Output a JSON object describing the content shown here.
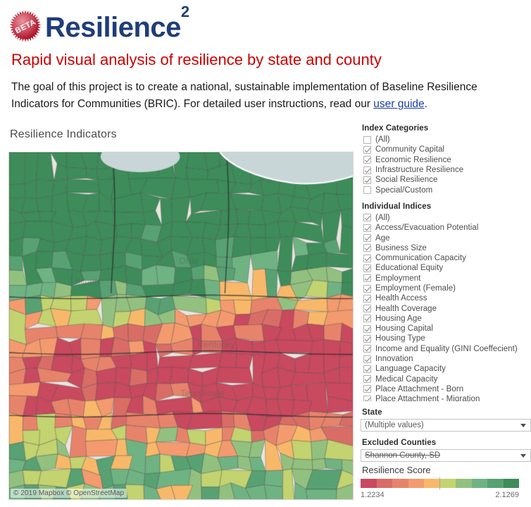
{
  "brand": {
    "badge_text": "BETA",
    "name": "Resilience",
    "superscript": "2",
    "badge_color": "#c02032",
    "name_color": "#1f3d7a"
  },
  "subtitle": "Rapid visual analysis of resilience by state and county",
  "intro": {
    "part1": "The goal of this project is to create a national, sustainable implementation of Baseline Resilience Indicators for Communities (BRIC). For detailed user instructions, read our ",
    "link_text": "user guide",
    "part2": "."
  },
  "map": {
    "title": "Resilience Indicators",
    "attribution": "© 2019 Mapbox  © OpenStreetMap",
    "water_color": "#c9d6d8",
    "visible_state_labels": [
      "Illinois",
      "Ohio",
      "Kentucky",
      "Tennessee"
    ]
  },
  "index_categories": {
    "label": "Index Categories",
    "items": [
      {
        "label": "(All)",
        "checked": false
      },
      {
        "label": "Community Capital",
        "checked": true
      },
      {
        "label": "Economic Resilience",
        "checked": true
      },
      {
        "label": "Infrastructure Resilience",
        "checked": true
      },
      {
        "label": "Social Resilience",
        "checked": true
      },
      {
        "label": "Special/Custom",
        "checked": false
      }
    ]
  },
  "individual_indices": {
    "label": "Individual Indices",
    "items": [
      {
        "label": "(All)",
        "checked": true
      },
      {
        "label": "Access/Evacuation Potential",
        "checked": true
      },
      {
        "label": "Age",
        "checked": true
      },
      {
        "label": "Business Size",
        "checked": true
      },
      {
        "label": "Communication Capacity",
        "checked": true
      },
      {
        "label": "Educational Equity",
        "checked": true
      },
      {
        "label": "Employment",
        "checked": true
      },
      {
        "label": "Employment (Female)",
        "checked": true
      },
      {
        "label": "Health Access",
        "checked": true
      },
      {
        "label": "Health Coverage",
        "checked": true
      },
      {
        "label": "Housing Age",
        "checked": true
      },
      {
        "label": "Housing Capital",
        "checked": true
      },
      {
        "label": "Housing Type",
        "checked": true
      },
      {
        "label": "Income and Equality (GINI Coeffecient)",
        "checked": true
      },
      {
        "label": "Innovation",
        "checked": true
      },
      {
        "label": "Language Capacity",
        "checked": true
      },
      {
        "label": "Medical Capacity",
        "checked": true
      },
      {
        "label": "Place Attachment - Born",
        "checked": true
      },
      {
        "label": "Place Attachment - Migration",
        "checked": true
      }
    ]
  },
  "state_filter": {
    "label": "State",
    "value": "(Multiple values)"
  },
  "excluded_counties": {
    "label": "Excluded Counties",
    "value": "Shannon County, SD",
    "struck_through": true
  },
  "legend": {
    "title": "Resilience Score",
    "min": "1.2234",
    "max": "2.1269",
    "colors": [
      "#c9495f",
      "#d96d66",
      "#e8836b",
      "#f39b6e",
      "#f8b86a",
      "#c3d36f",
      "#92c17f",
      "#6fb383",
      "#58a173",
      "#3d8c5a"
    ]
  },
  "icons": {
    "dropdown": "chevron-down-icon"
  }
}
